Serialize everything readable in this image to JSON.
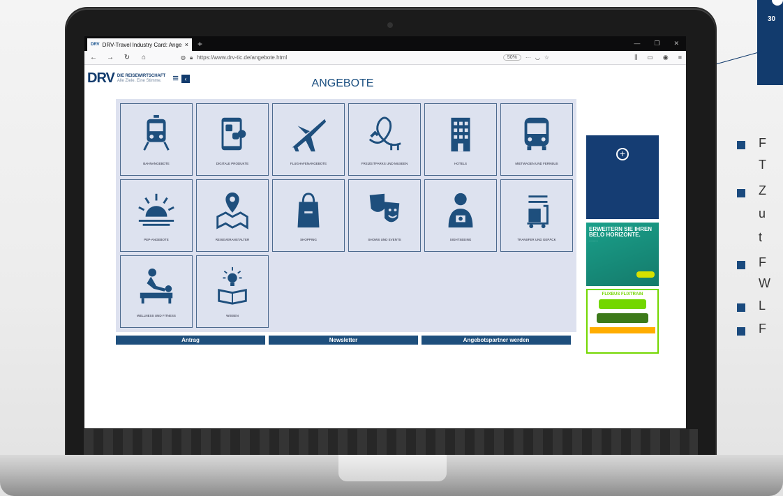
{
  "browser": {
    "tab_favicon": "DRV",
    "tab_title": "DRV-Travel Industry Card: Ange",
    "tab_close": "×",
    "new_tab": "+",
    "url": "https://www.drv-tic.de/angebote.html",
    "zoom": "50%",
    "more": "···"
  },
  "site": {
    "logo": "DRV",
    "logo_title": "DIE REISEWIRTSCHAFT",
    "logo_slogan": "Alle Ziele. Eine Stimme.",
    "page_title": "ANGEBOTE"
  },
  "categories": [
    {
      "label": "BAHNANGEBOTE",
      "icon": "train-icon"
    },
    {
      "label": "DIGITALE PRODUKTE",
      "icon": "smartphone-icon"
    },
    {
      "label": "FLUGHAFENANGEBOTE",
      "icon": "airplane-icon"
    },
    {
      "label": "FREIZEITPARKS UND MUSEEN",
      "icon": "rollercoaster-icon"
    },
    {
      "label": "HOTELS",
      "icon": "hotel-icon"
    },
    {
      "label": "MIETWAGEN UND FERNBUS",
      "icon": "bus-icon"
    },
    {
      "label": "PEP-ANGEBOTE",
      "icon": "sunrise-icon"
    },
    {
      "label": "REISEVERANSTALTER",
      "icon": "map-pin-icon"
    },
    {
      "label": "SHOPPING",
      "icon": "shopping-bag-icon"
    },
    {
      "label": "SHOWS UND EVENTS",
      "icon": "theater-masks-icon"
    },
    {
      "label": "SIGHTSEEING",
      "icon": "tourist-icon"
    },
    {
      "label": "TRANSFER UND GEPÄCK",
      "icon": "luggage-cart-icon"
    },
    {
      "label": "WELLNESS UND FITNESS",
      "icon": "massage-icon"
    },
    {
      "label": "WISSEN",
      "icon": "lightbulb-book-icon"
    }
  ],
  "actions": {
    "antrag": "Antrag",
    "newsletter": "Newsletter",
    "partner": "Angebotspartner werden"
  },
  "ads": {
    "sunny_headline": "ERWEITERN SIE IHREN BELO HORIZONTE.",
    "flix_headline": "FLIXBUS FLIXTRAIN"
  },
  "slide": {
    "callout_number": "30",
    "bullets": [
      "F",
      "Z",
      "F",
      "L",
      "F"
    ],
    "bullet_lines": [
      "T",
      "u",
      "t",
      "W"
    ]
  },
  "colors": {
    "brand_blue": "#123b6d",
    "tile_bg": "#dde2ef",
    "flix_green": "#73d700"
  }
}
